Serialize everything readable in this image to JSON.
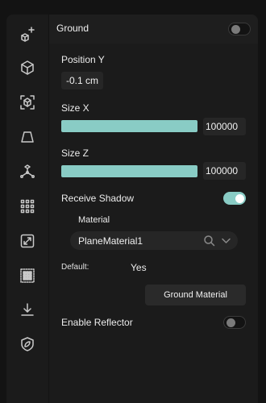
{
  "header": {
    "title": "Ground",
    "enabled": false
  },
  "rail": {
    "icons": [
      "shapes-add-icon",
      "cube-icon",
      "cube-frame-icon",
      "plane-trapezoid-icon",
      "axis-gizmo-icon",
      "grid-dots-icon",
      "resize-arrows-icon",
      "dense-grid-icon",
      "download-icon",
      "leaf-shield-icon"
    ]
  },
  "position_y": {
    "label": "Position Y",
    "value": "-0.1 cm"
  },
  "size_x": {
    "label": "Size X",
    "value": "100000",
    "fill_fraction": 1.0
  },
  "size_z": {
    "label": "Size Z",
    "value": "100000",
    "fill_fraction": 1.0
  },
  "receive_shadow": {
    "label": "Receive Shadow",
    "enabled": true
  },
  "material": {
    "label": "Material",
    "selected": "PlaneMaterial1",
    "default_label": "Default:",
    "default_value": "Yes",
    "button_label": "Ground Material"
  },
  "reflector": {
    "label": "Enable Reflector",
    "enabled": false
  },
  "colors": {
    "accent": "#89ccc5",
    "panel": "#1b1b1b",
    "background": "#131313"
  }
}
